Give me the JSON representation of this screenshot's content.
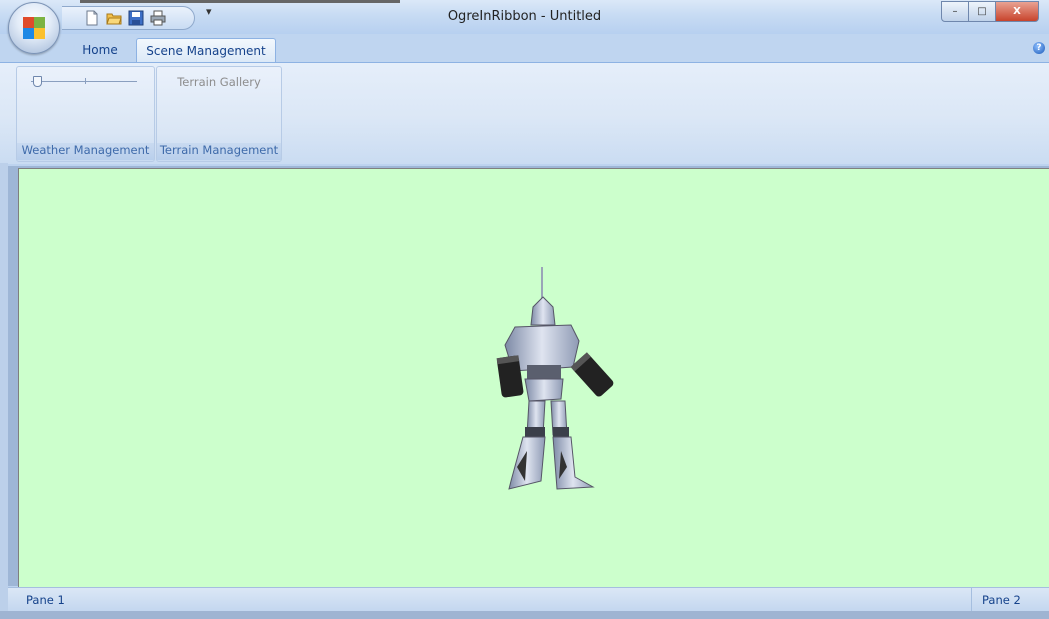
{
  "window": {
    "title": "OgreInRibbon - Untitled"
  },
  "quick_access": {
    "icons": [
      "new-document-icon",
      "open-folder-icon",
      "save-icon",
      "print-icon"
    ],
    "customize": "▾"
  },
  "caption_buttons": {
    "minimize": "–",
    "maximize": "□",
    "close": "X"
  },
  "tabs": [
    {
      "label": "Home",
      "active": false
    },
    {
      "label": "Scene Management",
      "active": true
    }
  ],
  "help": "?",
  "ribbon": {
    "groups": [
      {
        "name": "weather",
        "label": "Weather Management",
        "control": "slider",
        "slider_value": 0
      },
      {
        "name": "terrain",
        "label": "Terrain Management",
        "control": "gallery",
        "gallery_label": "Terrain Gallery"
      }
    ]
  },
  "viewport": {
    "background": "#ccffcc",
    "content": "robot-model"
  },
  "statusbar": {
    "pane1": "Pane 1",
    "pane2": "Pane 2"
  },
  "colors": {
    "accent": "#15428b",
    "ribbon": "#dbe7f6",
    "viewport": "#ccffcc"
  }
}
